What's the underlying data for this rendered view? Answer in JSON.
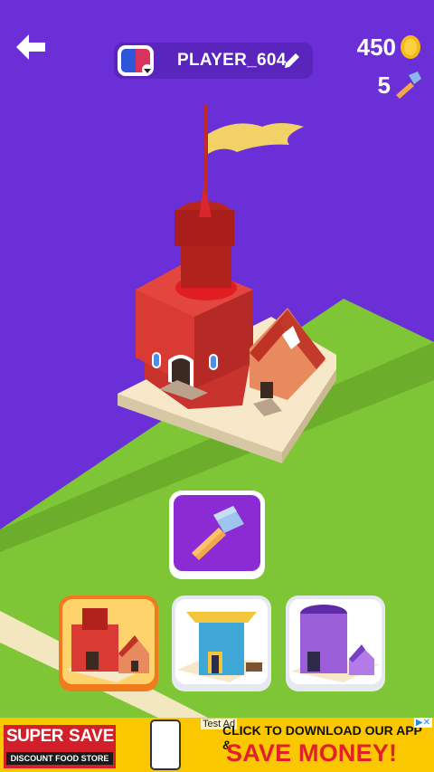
{
  "header": {
    "player_name": "PLAYER_604",
    "coins": "450",
    "hammers": "5"
  },
  "icons": {
    "back": "back-arrow-icon",
    "flag": "flag-icon",
    "edit": "pencil-icon",
    "coin": "coin-icon",
    "hammer": "hammer-icon"
  },
  "buildings": [
    {
      "name": "red-castle",
      "selected": true
    },
    {
      "name": "pagoda-tower",
      "selected": false
    },
    {
      "name": "purple-tower",
      "selected": false
    }
  ],
  "colors": {
    "background": "#6a2fd6",
    "grass": "#7ec636",
    "button": "#8a2bd3",
    "selected_border": "#f07a1c",
    "coin": "#f6b918"
  },
  "ad": {
    "brand_left": "SUPER",
    "brand_right": "SAVE",
    "brand_sub": "DISCOUNT FOOD STORE",
    "test_label": "Test Ad",
    "line1": "CLICK TO DOWNLOAD OUR APP &",
    "line2": "SAVE MONEY!"
  }
}
